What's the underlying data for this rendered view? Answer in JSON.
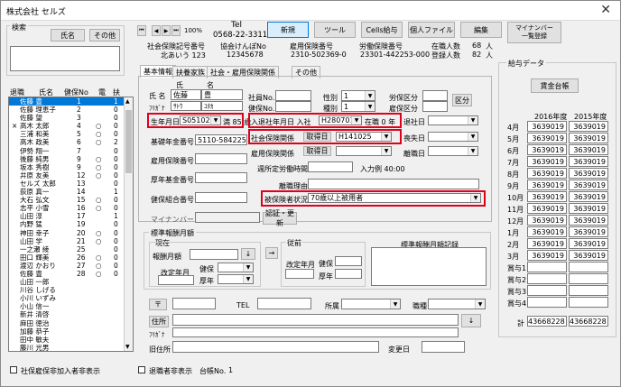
{
  "title": "株式会社 セルズ",
  "close_glyph": "✕",
  "search": {
    "group_label": "検索",
    "name_btn": "氏名",
    "other_btn": "その他"
  },
  "nav": {
    "first": "⏮",
    "prev": "◀",
    "next": "▶",
    "last": "⏭",
    "zoom": "100%"
  },
  "tel": {
    "label": "Tel",
    "value": "0568-22-3311"
  },
  "toolbar": {
    "new": "新規",
    "tools": "ツール",
    "cells_pay": "Cells給与",
    "personal_file": "個人ファイル",
    "edit": "編集",
    "mynumber": "マイナンバー\n一覧登録"
  },
  "insurance": {
    "hdr_symbol": "社会保険記号番号",
    "hdr_kyokai": "協会けんぽNo",
    "hdr_koyo": "雇用保険番号",
    "hdr_rodo": "労働保険番号",
    "symbol": "北あいう 123",
    "kyokai": "12345678",
    "koyo": "2310-502369-0",
    "rodo": "23301-442253-000",
    "active_label": "在職人数",
    "active_count": "68",
    "active_unit": "人",
    "registered_label": "登録人数",
    "registered_count": "82",
    "registered_unit": "人"
  },
  "tabs": [
    "基本情報",
    "扶養家族",
    "社会・雇用保険関係",
    "その他"
  ],
  "list": {
    "headers": [
      "退職",
      "氏名",
      "健保No",
      "電",
      "扶"
    ],
    "rows": [
      {
        "ret": "",
        "name": "佐藤 豊",
        "no": "1",
        "den": "",
        "fu": "1"
      },
      {
        "ret": "",
        "name": "佐藤 理恵子",
        "no": "2",
        "den": "",
        "fu": "0"
      },
      {
        "ret": "",
        "name": "佐藤 望",
        "no": "3",
        "den": "",
        "fu": "0"
      },
      {
        "ret": "×",
        "name": "高木 太郎",
        "no": "4",
        "den": "○",
        "fu": "0"
      },
      {
        "ret": "",
        "name": "三浦 和美",
        "no": "5",
        "den": "○",
        "fu": "0"
      },
      {
        "ret": "",
        "name": "高木 政美",
        "no": "6",
        "den": "○",
        "fu": "2"
      },
      {
        "ret": "",
        "name": "伊勢 翔一",
        "no": "7",
        "den": "",
        "fu": "0"
      },
      {
        "ret": "",
        "name": "後藤 純男",
        "no": "9",
        "den": "○",
        "fu": "0"
      },
      {
        "ret": "",
        "name": "坂本 秀樹",
        "no": "9",
        "den": "○",
        "fu": "0"
      },
      {
        "ret": "",
        "name": "井原 友美",
        "no": "12",
        "den": "○",
        "fu": "0"
      },
      {
        "ret": "",
        "name": "セルズ 太郎",
        "no": "13",
        "den": "",
        "fu": "0"
      },
      {
        "ret": "",
        "name": "荻原 真一",
        "no": "14",
        "den": "",
        "fu": "1"
      },
      {
        "ret": "",
        "name": "大石 弘文",
        "no": "15",
        "den": "○",
        "fu": "0"
      },
      {
        "ret": "",
        "name": "志平 小雪",
        "no": "16",
        "den": "○",
        "fu": "0"
      },
      {
        "ret": "",
        "name": "山田 淳",
        "no": "17",
        "den": "",
        "fu": "1"
      },
      {
        "ret": "",
        "name": "内野 猛",
        "no": "19",
        "den": "",
        "fu": "0"
      },
      {
        "ret": "",
        "name": "神田 幸子",
        "no": "20",
        "den": "○",
        "fu": "0"
      },
      {
        "ret": "",
        "name": "山田 学",
        "no": "21",
        "den": "○",
        "fu": "0"
      },
      {
        "ret": "",
        "name": "一之瀬 綾",
        "no": "25",
        "den": "",
        "fu": "0"
      },
      {
        "ret": "",
        "name": "田口 輝美",
        "no": "26",
        "den": "○",
        "fu": "0"
      },
      {
        "ret": "",
        "name": "渡辺 かおり",
        "no": "27",
        "den": "○",
        "fu": "0"
      },
      {
        "ret": "",
        "name": "佐藤 豊",
        "no": "28",
        "den": "○",
        "fu": "0"
      },
      {
        "ret": "",
        "name": "山田 一郎",
        "no": "",
        "den": "",
        "fu": ""
      },
      {
        "ret": "",
        "name": "川谷 しげる",
        "no": "",
        "den": "",
        "fu": ""
      },
      {
        "ret": "",
        "name": "小川 いずみ",
        "no": "",
        "den": "",
        "fu": ""
      },
      {
        "ret": "",
        "name": "小山 信一",
        "no": "",
        "den": "",
        "fu": ""
      },
      {
        "ret": "",
        "name": "新井 清啓",
        "no": "",
        "den": "",
        "fu": ""
      },
      {
        "ret": "",
        "name": "麻田 徳治",
        "no": "",
        "den": "",
        "fu": ""
      },
      {
        "ret": "",
        "name": "加藤 恭子",
        "no": "",
        "den": "",
        "fu": ""
      },
      {
        "ret": "",
        "name": "田中 敏夫",
        "no": "",
        "den": "",
        "fu": ""
      },
      {
        "ret": "",
        "name": "藤川 光男",
        "no": "",
        "den": "",
        "fu": ""
      }
    ]
  },
  "basic": {
    "sei_label": "氏",
    "mei_label": "名",
    "name_label": "氏 名",
    "name_sei": "佐藤",
    "name_mei": "豊",
    "kana_label": "ﾌﾘｶﾞﾅ",
    "kana_sei": "ｻﾄｳ",
    "kana_mei": "ﾕﾀｶ",
    "emp_no_label": "社員No.",
    "health_no_label": "健保No.",
    "gender_label": "性別",
    "gender_value": "1",
    "kind_label": "種別",
    "kind_value": "1",
    "labor_label": "労保区分",
    "koyo_kubun_label": "雇保区分",
    "kubun_btn": "区分",
    "birth_label": "生年月日",
    "birth_value": "S051025",
    "age_text": "満 85 歳",
    "entry_label": "入退社年月日 入社",
    "entry_value": "H280701",
    "tenure_text": "在職 0 年",
    "retire_label": "退社日",
    "pension_label": "基礎年金番号",
    "pension_value": "5110-584225",
    "shaho_label": "社会保険関係",
    "shaho_btn": "取得日",
    "shaho_value": "H141025",
    "soshitsu_label": "喪失日",
    "koyo_no_label": "雇用保険番号",
    "koyo_rel_label": "雇用保険関係",
    "koyo_btn": "取得日",
    "rishoku_label": "離職日",
    "kosei_label": "厚年基金番号",
    "hours_label": "週所定労働時間",
    "hours_text": "入力例 40:00",
    "reason_label": "離職理由",
    "kumiai_label": "健保組合番号",
    "status_label": "被保険者状況",
    "status_value": "70歳以上被用者",
    "mynumber_label": "マイナンバー",
    "auth_btn": "認証・更新"
  },
  "std": {
    "group_label": "標準報酬月額",
    "current_label": "現在",
    "monthly_label": "報酬月額",
    "revision_label": "改定年月",
    "kenpo_label": "健保",
    "kounen_label": "厚年",
    "prev_label": "従前",
    "prev_revision_label": "改定年月",
    "prev_kenpo_label": "健保",
    "prev_kounen_label": "厚年",
    "record_label": "標準報酬月額記録",
    "arrow_btn": "→",
    "down_btn": "↓"
  },
  "address": {
    "zip_btn": "〒",
    "tel_label": "TEL",
    "affil_label": "所属",
    "job_label": "職種",
    "addr_btn": "住所",
    "kana_label": "ﾌﾘｶﾞﾅ",
    "old_label": "旧住所",
    "change_label": "変更日",
    "down_btn": "↓"
  },
  "salary": {
    "group_label": "給与データ",
    "ledger_btn": "賃金台帳",
    "year1": "2016年度",
    "year2": "2015年度",
    "months": [
      {
        "m": "4月",
        "a": "3639019",
        "b": "3639019"
      },
      {
        "m": "5月",
        "a": "3639019",
        "b": "3639019"
      },
      {
        "m": "6月",
        "a": "3639019",
        "b": "3639019"
      },
      {
        "m": "7月",
        "a": "3639019",
        "b": "3639019"
      },
      {
        "m": "8月",
        "a": "3639019",
        "b": "3639019"
      },
      {
        "m": "9月",
        "a": "3639019",
        "b": "3639019"
      },
      {
        "m": "10月",
        "a": "3639019",
        "b": "3639019"
      },
      {
        "m": "11月",
        "a": "3639019",
        "b": "3639019"
      },
      {
        "m": "12月",
        "a": "3639019",
        "b": "3639019"
      },
      {
        "m": "1月",
        "a": "3639019",
        "b": "3639019"
      },
      {
        "m": "2月",
        "a": "3639019",
        "b": "3639019"
      },
      {
        "m": "3月",
        "a": "3639019",
        "b": "3639019"
      },
      {
        "m": "賞与1",
        "a": "",
        "b": ""
      },
      {
        "m": "賞与2",
        "a": "",
        "b": ""
      },
      {
        "m": "賞与3",
        "a": "",
        "b": ""
      },
      {
        "m": "賞与4",
        "a": "",
        "b": ""
      }
    ],
    "total_label": "計",
    "total_a": "43668228",
    "total_b": "43668228"
  },
  "footer": {
    "shaho_nonmember": "社保雇保非加入者非表示",
    "retired_hide": "退職者非表示",
    "ledger_no_label": "台帳No.",
    "ledger_no": "1"
  },
  "colors": {
    "highlight": "#e0001b",
    "selection": "#0078d7"
  }
}
